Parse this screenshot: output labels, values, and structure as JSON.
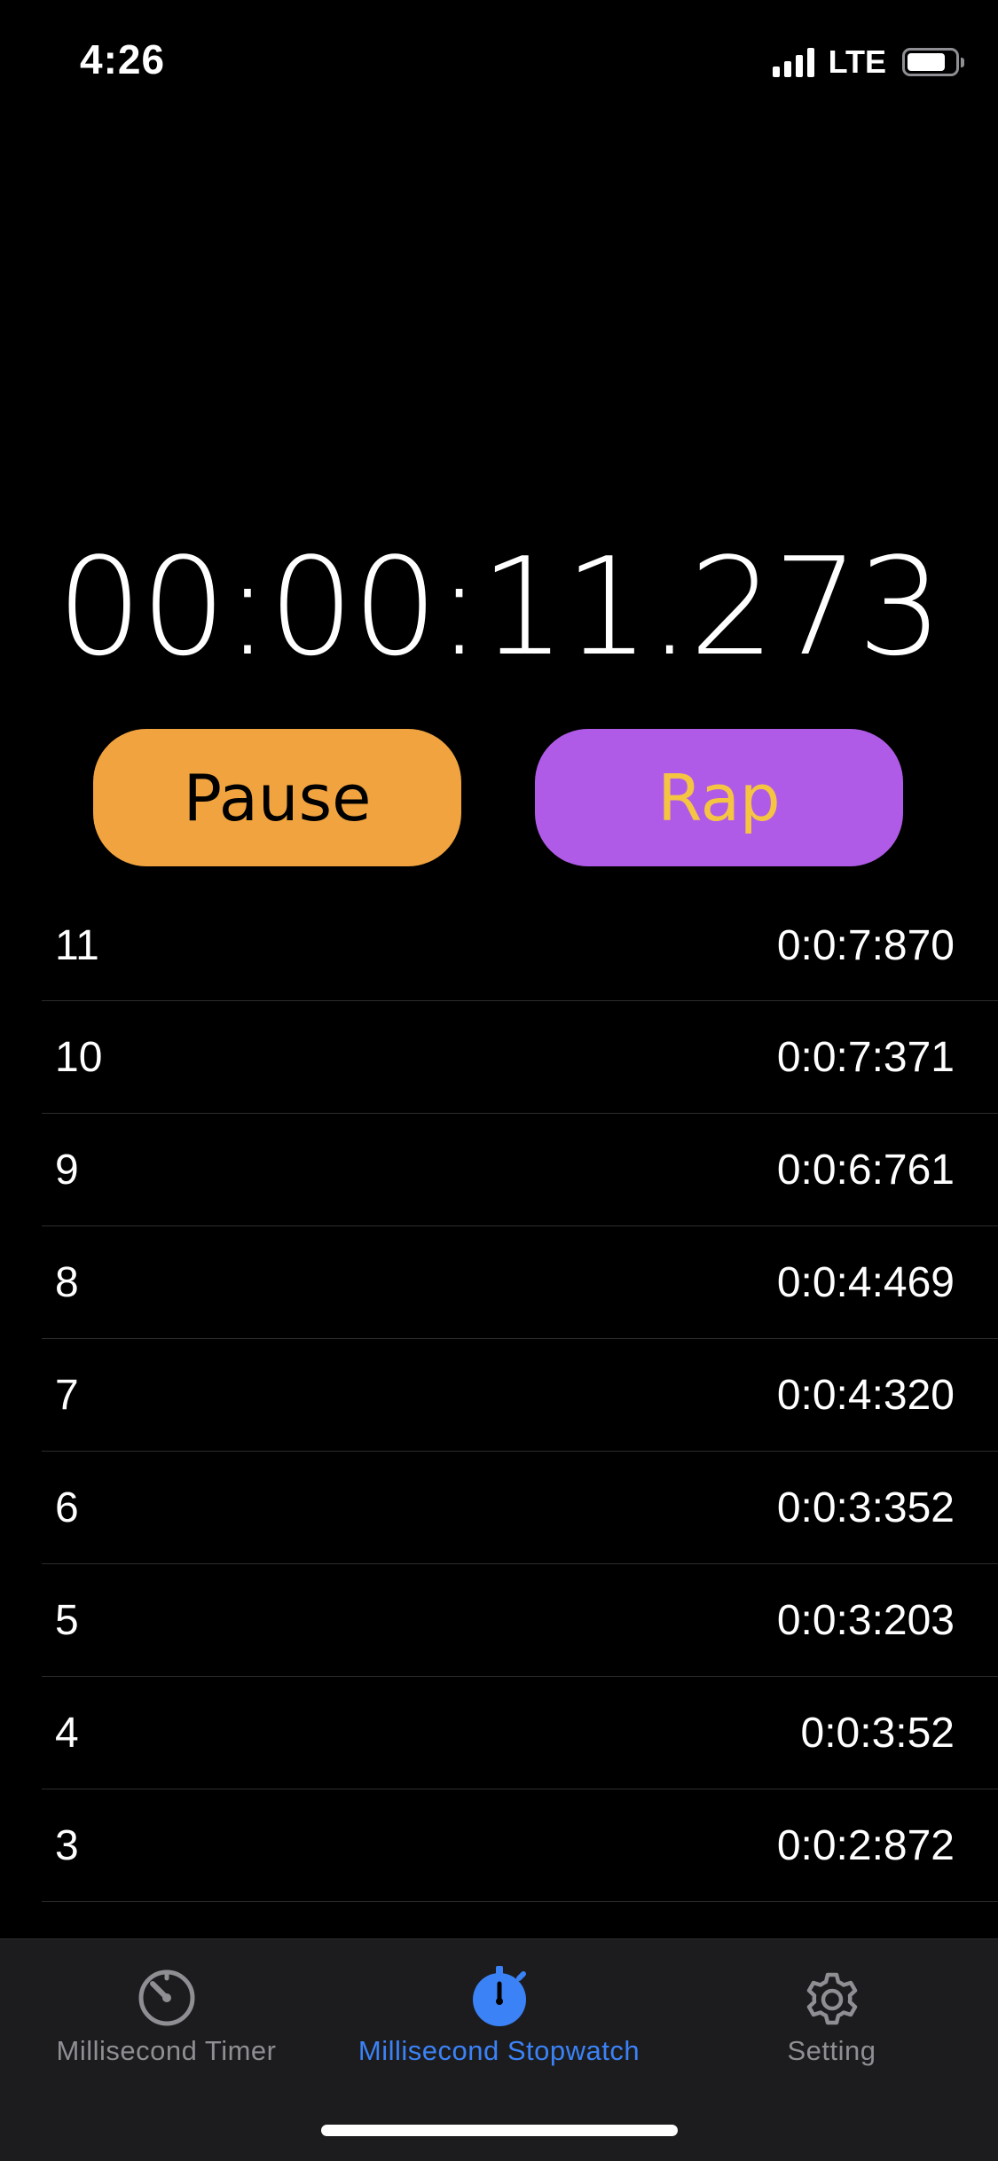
{
  "status_bar": {
    "time": "4:26",
    "network": "LTE",
    "battery_level": 0.8
  },
  "timer": {
    "display": "00:00:11.273"
  },
  "controls": {
    "pause_label": "Pause",
    "rap_label": "Rap"
  },
  "laps": [
    {
      "number": "11",
      "time": "0:0:7:870"
    },
    {
      "number": "10",
      "time": "0:0:7:371"
    },
    {
      "number": "9",
      "time": "0:0:6:761"
    },
    {
      "number": "8",
      "time": "0:0:4:469"
    },
    {
      "number": "7",
      "time": "0:0:4:320"
    },
    {
      "number": "6",
      "time": "0:0:3:352"
    },
    {
      "number": "5",
      "time": "0:0:3:203"
    },
    {
      "number": "4",
      "time": "0:0:3:52"
    },
    {
      "number": "3",
      "time": "0:0:2:872"
    }
  ],
  "tab_bar": {
    "items": [
      {
        "label": "Millisecond Timer",
        "icon": "timer-icon",
        "active": false
      },
      {
        "label": "Millisecond Stopwatch",
        "icon": "stopwatch-icon",
        "active": true
      },
      {
        "label": "Setting",
        "icon": "gear-icon",
        "active": false
      }
    ]
  },
  "colors": {
    "background": "#000000",
    "pause_button": "#f1a33f",
    "rap_button": "#b05be8",
    "rap_text": "#f5c542",
    "tab_active": "#3b82f6",
    "tab_inactive": "#8e8e93"
  }
}
